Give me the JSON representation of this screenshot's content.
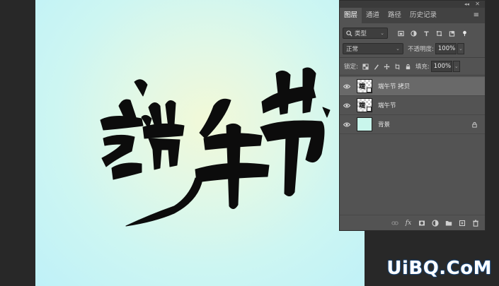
{
  "canvas": {
    "artwork_text": "端午节",
    "colors": {
      "gradient_center": "#f2f9d8",
      "gradient_edge": "#bff1f8",
      "ink": "#0c0c0c"
    }
  },
  "panel": {
    "tabs": [
      {
        "label": "图层",
        "active": true
      },
      {
        "label": "通道",
        "active": false
      },
      {
        "label": "路径",
        "active": false
      },
      {
        "label": "历史记录",
        "active": false
      }
    ],
    "filter": {
      "label": "类型"
    },
    "blend_mode": "正常",
    "opacity": {
      "label": "不透明度:",
      "value": "100%"
    },
    "lock": {
      "label": "锁定:"
    },
    "fill": {
      "label": "填充:",
      "value": "100%"
    },
    "layers": [
      {
        "name": "端午节 拷贝",
        "selected": true,
        "type": "smart-object"
      },
      {
        "name": "端午节",
        "selected": false,
        "type": "smart-object"
      },
      {
        "name": "背景",
        "selected": false,
        "type": "background",
        "locked": true
      }
    ],
    "bottom_icons": [
      "link-icon",
      "fx-icon",
      "mask-icon",
      "adjustment-icon",
      "folder-icon",
      "new-layer-icon",
      "trash-icon"
    ]
  },
  "watermark": {
    "text": "UiBQ.CoM"
  }
}
